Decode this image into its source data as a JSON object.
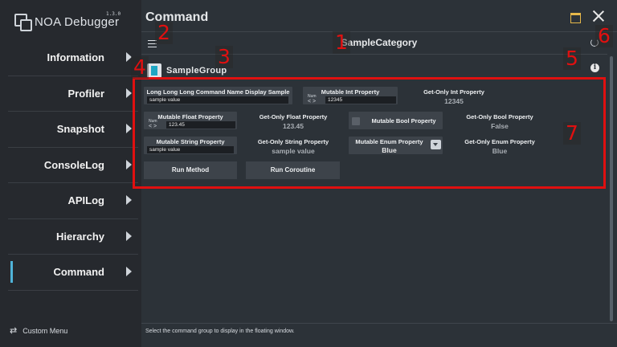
{
  "app": {
    "title": "NOA Debugger",
    "version": "1.3.0"
  },
  "sidebar": {
    "items": [
      {
        "label": "Information"
      },
      {
        "label": "Profiler"
      },
      {
        "label": "Snapshot"
      },
      {
        "label": "ConsoleLog"
      },
      {
        "label": "APILog"
      },
      {
        "label": "Hierarchy"
      },
      {
        "label": "Command",
        "active": true
      }
    ],
    "custom_menu": "Custom Menu"
  },
  "header": {
    "title": "Command",
    "category": "SampleCategory"
  },
  "group": {
    "title": "SampleGroup"
  },
  "commands": {
    "long_name": {
      "title": "Long Long Long Command Name Display Sample",
      "value": "sample value"
    },
    "mutable_int": {
      "title": "Mutable Int Property",
      "num_label": "Num",
      "arrows": "< >",
      "value": "12345"
    },
    "getonly_int": {
      "title": "Get-Only Int Property",
      "value": "12345"
    },
    "mutable_float": {
      "title": "Mutable Float Property",
      "num_label": "Num",
      "arrows": "< >",
      "value": "123.45"
    },
    "getonly_float": {
      "title": "Get-Only Float Property",
      "value": "123.45"
    },
    "mutable_bool": {
      "title": "Mutable Bool Property"
    },
    "getonly_bool": {
      "title": "Get-Only Bool Property",
      "value": "False"
    },
    "mutable_string": {
      "title": "Mutable String Property",
      "value": "sample value"
    },
    "getonly_string": {
      "title": "Get-Only String Property",
      "value": "sample value"
    },
    "mutable_enum": {
      "title": "Mutable Enum Property",
      "value": "Blue"
    },
    "getonly_enum": {
      "title": "Get-Only Enum Property",
      "value": "Blue"
    },
    "run_method": "Run Method",
    "run_coroutine": "Run Coroutine"
  },
  "footer": {
    "text": "Select the command group to display in the floating window."
  },
  "annotations": {
    "n1": "1",
    "n2": "2",
    "n3": "3",
    "n4": "4",
    "n5": "5",
    "n6": "6",
    "n7": "7"
  },
  "colors": {
    "accent": "#4fb3d9",
    "callout": "#e01010",
    "window_icon": "#e6b84a"
  }
}
